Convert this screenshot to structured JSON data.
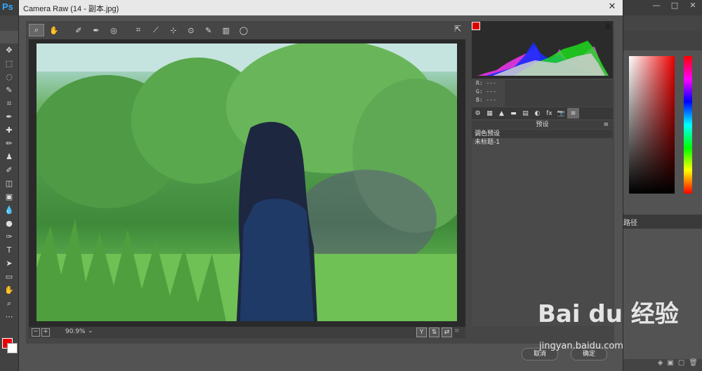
{
  "ps": {
    "logo": "Ps",
    "window_buttons": [
      "—",
      "□",
      "✕"
    ],
    "right_tab_label": "路径"
  },
  "dialog": {
    "title": "Camera Raw (14 - 副本.jpg)",
    "close": "✕"
  },
  "toolbar": {
    "tools": [
      {
        "name": "zoom-tool",
        "glyph": "🔍"
      },
      {
        "name": "hand-tool",
        "glyph": "✋"
      },
      {
        "name": "white-balance-tool",
        "glyph": "✐"
      },
      {
        "name": "color-sampler-tool",
        "glyph": "✒"
      },
      {
        "name": "targeted-adjustment-tool",
        "glyph": "◎"
      },
      {
        "name": "crop-tool",
        "glyph": "⌗"
      },
      {
        "name": "straighten-tool",
        "glyph": "⟋"
      },
      {
        "name": "spot-removal-tool",
        "glyph": "⊹"
      },
      {
        "name": "red-eye-tool",
        "glyph": "⊙"
      },
      {
        "name": "adjustment-brush-tool",
        "glyph": "✎"
      },
      {
        "name": "graduated-filter-tool",
        "glyph": "▥"
      },
      {
        "name": "radial-filter-tool",
        "glyph": "◯"
      }
    ]
  },
  "zoom": {
    "value": "90.9%",
    "minus": "−",
    "plus": "+"
  },
  "view_buttons": [
    "Y",
    "⇅",
    "⇄"
  ],
  "readout": {
    "r": "R:  ---",
    "g": "G:  ---",
    "b": "B:  ---"
  },
  "panel_tabs": [
    "⚙",
    "▦",
    "▲",
    "▬",
    "▤",
    "◐",
    "fx",
    "📷",
    "≡"
  ],
  "presets": {
    "header": "预设",
    "folder": "调色预设",
    "items": [
      "未标题-1"
    ]
  },
  "footer": {
    "cancel": "取消",
    "ok": "确定"
  },
  "watermark": {
    "brand": "Bai du 经验",
    "url": "jingyan.baidu.com"
  }
}
